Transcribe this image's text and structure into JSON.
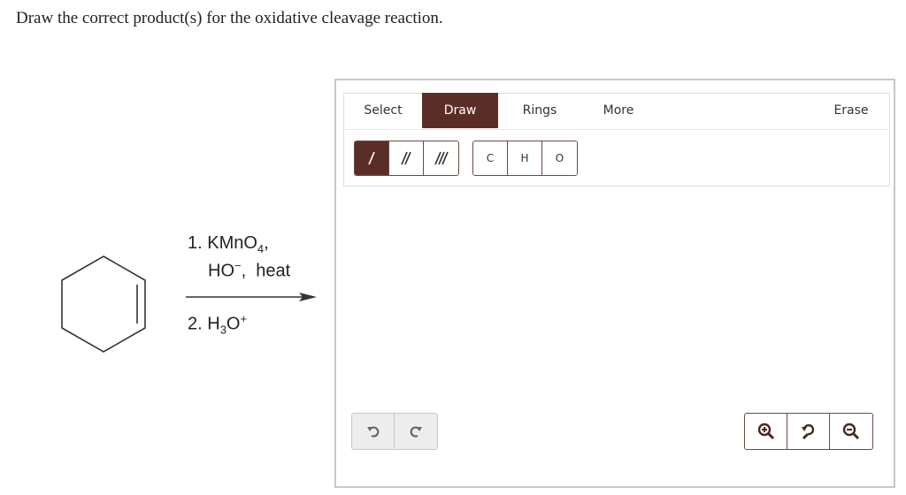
{
  "question": "Draw the correct product(s) for the oxidative cleavage reaction.",
  "reaction": {
    "step1_number": "1. KMnO",
    "step1_sub": "4",
    "step1_tail": ",",
    "step1_line2_a": "HO",
    "step1_line2_sup": "−",
    "step1_line2_b": ",  heat",
    "step2_a": "2. H",
    "step2_sub": "3",
    "step2_b": "O",
    "step2_sup": "+"
  },
  "editor": {
    "tabs": [
      {
        "label": "Select"
      },
      {
        "label": "Draw"
      },
      {
        "label": "Rings"
      },
      {
        "label": "More"
      },
      {
        "label": "Erase"
      }
    ],
    "active_tab": "Draw",
    "bonds": [
      "single-bond-icon",
      "double-bond-icon",
      "triple-bond-icon"
    ],
    "atoms": [
      "C",
      "H",
      "O"
    ],
    "history": [
      "undo-icon",
      "redo-icon"
    ],
    "zoom": [
      "zoom-in-icon",
      "reset-zoom-icon",
      "zoom-out-icon"
    ]
  },
  "colors": {
    "accent": "#5a2e26",
    "border": "#6a4a40",
    "disabled_bg": "#ededed"
  }
}
